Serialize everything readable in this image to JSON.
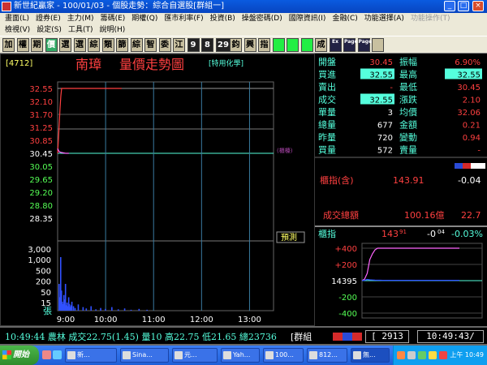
{
  "window": {
    "title": "新世紀贏家 - 100/01/03 - 個股走勢：綜合自選股[群組一]",
    "minimize_label": "_",
    "maximize_label": "□",
    "close_label": "×"
  },
  "menu": {
    "row1": [
      "畫面(L)",
      "證券(E)",
      "主力(M)",
      "籌碼(E)",
      "期權(Q)",
      "匯市利率(F)",
      "投資(B)",
      "操盤密碼(D)",
      "國際資訊(I)",
      "金融(C)",
      "功能選擇(A)",
      "功能操作(T)"
    ],
    "row2": [
      "檢視(V)",
      "設定(S)",
      "工具(T)",
      "說明(H)"
    ]
  },
  "toolbar": {
    "buttons": [
      "加",
      "權",
      "期",
      "價",
      "選",
      "選",
      "綜",
      "類",
      "篩",
      "綜",
      "智",
      "委",
      "江",
      "9",
      "8",
      "29",
      "鈞",
      "興",
      "指",
      "",
      "",
      "",
      "成",
      "Ex",
      "Page",
      "Page",
      ""
    ]
  },
  "chart": {
    "stock_code": "[4712]",
    "stock_name": "南璋",
    "chart_title": "量價走勢圖",
    "industry": "[特用化學]",
    "limit_label": "(櫃檯)",
    "simulated_badge": "預測",
    "volume_unit": "張",
    "price_ticks": [
      "32.55",
      "32.10",
      "31.70",
      "31.25",
      "30.85",
      "30.45",
      "30.05",
      "29.65",
      "29.20",
      "28.80",
      "28.35"
    ],
    "volume_ticks": [
      "3,000",
      "1,000",
      "500",
      "200",
      "50",
      "15"
    ],
    "time_ticks": [
      "9:00",
      "10:00",
      "11:00",
      "12:00",
      "13:00"
    ]
  },
  "chart_data": {
    "type": "line",
    "title": "量價走勢圖",
    "xlabel": "",
    "ylabel": "",
    "x_ticks": [
      "9:00",
      "10:00",
      "11:00",
      "12:00",
      "13:00"
    ],
    "ylim": [
      28.35,
      32.55
    ],
    "reference_price": 30.45,
    "series": [
      {
        "name": "成交",
        "x": [
          0,
          1,
          2,
          3,
          4,
          5,
          6,
          8,
          10,
          14,
          20,
          40,
          60,
          80
        ],
        "values": [
          30.45,
          30.9,
          31.4,
          31.9,
          32.3,
          32.55,
          32.55,
          32.55,
          32.55,
          32.55,
          32.55,
          32.55,
          32.55,
          32.55
        ]
      },
      {
        "name": "均價",
        "x": [
          0,
          2,
          4,
          6,
          8,
          10,
          14
        ],
        "values": [
          30.6,
          30.5,
          30.48,
          30.47,
          30.46,
          30.45,
          30.45
        ]
      }
    ],
    "volume": {
      "minutes": [
        0,
        1,
        2,
        3,
        4,
        5,
        6,
        7,
        8,
        9,
        10,
        11,
        12,
        13,
        14,
        15,
        16,
        18,
        20,
        24,
        30,
        34,
        40,
        46,
        52,
        58,
        66,
        74,
        82,
        90,
        100,
        110
      ],
      "values": [
        60,
        30,
        120,
        45,
        20,
        15,
        35,
        25,
        60,
        12,
        18,
        10,
        30,
        15,
        8,
        12,
        20,
        10,
        6,
        14,
        8,
        5,
        10,
        3,
        6,
        4,
        8,
        3,
        5,
        2,
        4,
        2
      ]
    },
    "index_series": {
      "name": "櫃指",
      "values": [
        0,
        20,
        90,
        260,
        330,
        380,
        400,
        400,
        400,
        400,
        400,
        400,
        400,
        400,
        400,
        400
      ],
      "avg_values": [
        0,
        5,
        15,
        10,
        8,
        6,
        5,
        5,
        4,
        4,
        4,
        4,
        4,
        4,
        4,
        4
      ],
      "ylim": [
        -400,
        400
      ],
      "y_ticks": [
        "+400",
        "+200",
        "14395",
        "-200",
        "-400"
      ]
    }
  },
  "quote": {
    "rows": [
      {
        "l_label": "開盤",
        "l_value": "30.45",
        "r_label": "振幅",
        "r_value": "6.90%"
      },
      {
        "l_label": "買進",
        "l_value": "32.55",
        "r_label": "最高",
        "r_value": "32.55"
      },
      {
        "l_label": "賣出",
        "l_value": "-",
        "r_label": "最低",
        "r_value": "30.45"
      },
      {
        "l_label": "成交",
        "l_value": "32.55",
        "r_label": "漲跌",
        "r_value": "2.10"
      },
      {
        "l_label": "單量",
        "l_value": "3",
        "r_label": "均價",
        "r_value": "32.06"
      },
      {
        "l_label": "總量",
        "l_value": "677",
        "r_label": "金額",
        "r_value": "0.21"
      },
      {
        "l_label": "昨量",
        "l_value": "720",
        "r_label": "變動",
        "r_value": "0.94"
      },
      {
        "l_label": "買量",
        "l_value": "572",
        "r_label": "賣量",
        "r_value": "-"
      }
    ],
    "index_label": "櫃指(含)",
    "index_value": "143.91",
    "index_change": "-0.04",
    "turnover_label": "成交總額",
    "turnover_value": "100.16億",
    "turnover_extra": "22.7",
    "mini_index_label": "櫃指",
    "mini_index_value": "143",
    "mini_index_decimal": "91",
    "mini_index_change": "-0",
    "mini_index_change_decimal": "04",
    "mini_index_pct": "-0.03%"
  },
  "status": {
    "ticker": "10:49:44 農林 成交22.75(1.45) 量10 高22.75 低21.65 總23736",
    "group": "[群組",
    "box_value": "[ 2913",
    "clock": "10:49:43/"
  },
  "taskbar": {
    "start_label": "開始",
    "tasks": [
      "新...",
      "Sina...",
      "元...",
      "Yah...",
      "100...",
      "812...",
      "無..."
    ],
    "clock": "上午 10:49"
  }
}
